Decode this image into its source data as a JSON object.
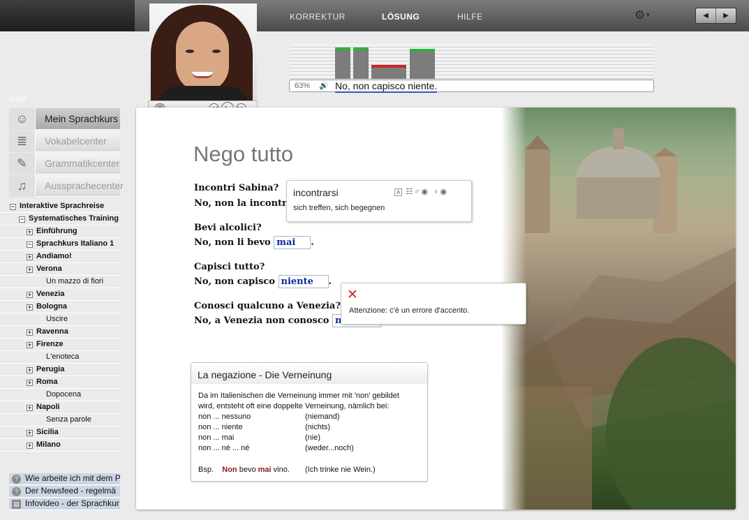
{
  "topbar": {
    "menu": [
      "KORREKTUR",
      "LÖSUNG",
      "HILFE"
    ],
    "active": "LÖSUNG"
  },
  "speech": {
    "percent": "63%",
    "recognized": "No, non capisco niente.",
    "bars": [
      {
        "level": 0.9,
        "status": "good"
      },
      {
        "level": 0.9,
        "status": "good"
      },
      {
        "level": 0.4,
        "status": "bad"
      },
      {
        "level": 0.85,
        "status": "good"
      }
    ],
    "colors": {
      "good": "#27b33a",
      "bad": "#c92424"
    }
  },
  "sidebar": {
    "heading": "Inhalt",
    "nav": [
      {
        "label": "Mein Sprachkurs",
        "icon": "headset-person-icon",
        "active": true
      },
      {
        "label": "Vokabelcenter",
        "icon": "words-icon",
        "active": false
      },
      {
        "label": "Grammatikcenter",
        "icon": "notepad-icon",
        "active": false
      },
      {
        "label": "Aussprachecenter",
        "icon": "headphones-icon",
        "active": false
      }
    ],
    "tree": [
      {
        "label": "Interaktive Sprachreise",
        "toggle": "−",
        "indent": 0,
        "bold": true
      },
      {
        "label": "Systematisches Training",
        "toggle": "−",
        "indent": 1,
        "bold": true
      },
      {
        "label": "Einführung",
        "toggle": "+",
        "indent": 2,
        "bold": true
      },
      {
        "label": "Sprachkurs Italiano 1",
        "toggle": "−",
        "indent": 2,
        "bold": true
      },
      {
        "label": "Andiamo!",
        "toggle": "+",
        "indent": 3,
        "bold": true
      },
      {
        "label": "Verona",
        "toggle": "+",
        "indent": 3,
        "bold": true
      },
      {
        "label": "Un mazzo di fiori",
        "toggle": "",
        "indent": 4,
        "bold": false
      },
      {
        "label": "Venezia",
        "toggle": "+",
        "indent": 3,
        "bold": true
      },
      {
        "label": "Bologna",
        "toggle": "+",
        "indent": 3,
        "bold": true
      },
      {
        "label": "Uscire",
        "toggle": "",
        "indent": 4,
        "bold": false
      },
      {
        "label": "Ravenna",
        "toggle": "+",
        "indent": 3,
        "bold": true
      },
      {
        "label": "Firenze",
        "toggle": "+",
        "indent": 3,
        "bold": true
      },
      {
        "label": "L'enoteca",
        "toggle": "",
        "indent": 4,
        "bold": false
      },
      {
        "label": "Perugia",
        "toggle": "+",
        "indent": 3,
        "bold": true
      },
      {
        "label": "Roma",
        "toggle": "+",
        "indent": 3,
        "bold": true
      },
      {
        "label": "Dopocena",
        "toggle": "",
        "indent": 4,
        "bold": false
      },
      {
        "label": "Napoli",
        "toggle": "+",
        "indent": 3,
        "bold": true
      },
      {
        "label": "Senza parole",
        "toggle": "",
        "indent": 4,
        "bold": false
      },
      {
        "label": "Sicilia",
        "toggle": "+",
        "indent": 3,
        "bold": true
      },
      {
        "label": "Milano",
        "toggle": "+",
        "indent": 3,
        "bold": true
      }
    ],
    "help": [
      "Wie arbeite ich mit dem P",
      "Der Newsfeed - regelmä",
      "Infovideo - der Sprachkur"
    ]
  },
  "lesson": {
    "title": "Nego tutto",
    "items": [
      {
        "question": "Incontri Sabina?",
        "answer_prefix": "No, non la incontro",
        "answer": "",
        "suffix": ""
      },
      {
        "question": "Bevi alcolici?",
        "answer_prefix": "No, non li bevo",
        "answer": "mai",
        "suffix": "."
      },
      {
        "question": "Capisci tutto?",
        "answer_prefix": "No, non capisco",
        "answer": "niente",
        "suffix": "."
      },
      {
        "question": "Conosci qualcuno a Venezia?",
        "answer_prefix": "No, a Venezia non conosco",
        "answer": "ne",
        "suffix": ""
      }
    ]
  },
  "vocab_popup": {
    "word": "incontrarsi",
    "translation": "sich treffen, sich begegnen",
    "icons": [
      "text-icon",
      "table-icon",
      "male-icon",
      "female-icon"
    ]
  },
  "error_popup": {
    "message": "Attenzione: c'è un errore d'accento."
  },
  "grammar": {
    "title": "La negazione - Die Verneinung",
    "intro": [
      "Da im Italienischen die Verneinung immer mit 'non' gebildet",
      "wird, entsteht oft eine doppelte Verneinung, nämlich bei:"
    ],
    "rows": [
      {
        "it": "non ... nessuno",
        "de": "(niemand)"
      },
      {
        "it": "non ... niente",
        "de": "(nichts)"
      },
      {
        "it": "non ... mai",
        "de": "(nie)"
      },
      {
        "it": "non ... né ... né",
        "de": "(weder...noch)"
      }
    ],
    "example": {
      "label": "Bsp.",
      "w1": "Non",
      "w2": "bevo",
      "w3": "mai",
      "w4": "vino.",
      "translation": "(Ich trinke nie Wein.)"
    }
  }
}
